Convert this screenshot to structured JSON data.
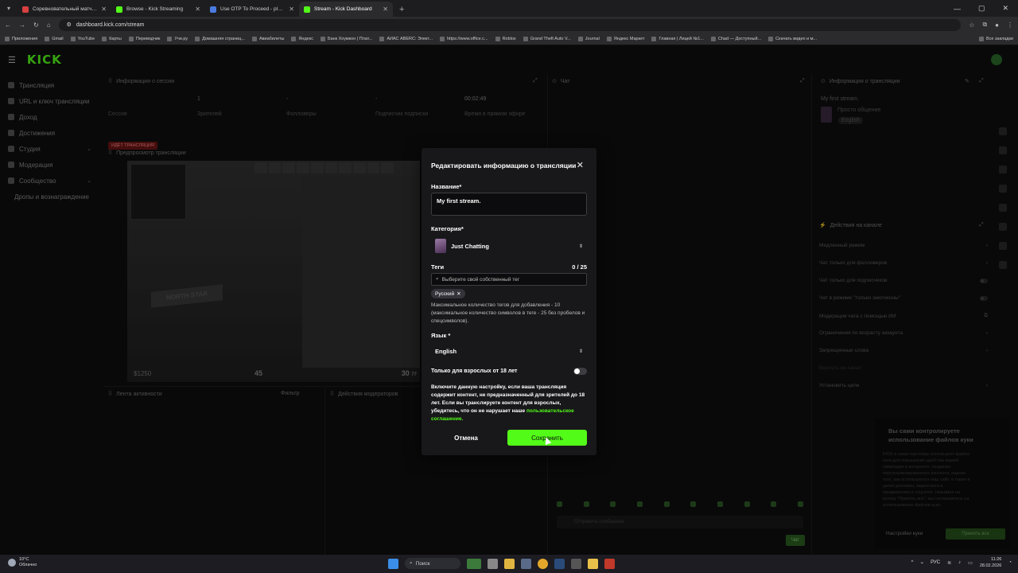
{
  "browser": {
    "tabs": [
      {
        "title": "Соревновательный матч FACEIT",
        "color": "#d94040",
        "active": false
      },
      {
        "title": "Browse - Kick Streaming",
        "color": "#53fc18",
        "active": false
      },
      {
        "title": "Use OTP To Proceed - playdig",
        "color": "#4b7be0",
        "active": false
      },
      {
        "title": "Stream - Kick Dashboard",
        "color": "#53fc18",
        "active": true
      }
    ],
    "url": "dashboard.kick.com/stream",
    "bookmarks": [
      "Приложения",
      "Gmail",
      "YouTube",
      "Карты",
      "Переводчик",
      "Учи.ру",
      "Домашняя страниц...",
      "Авиабилеты",
      "Яндекс",
      "Банк Хоумкон | Плат...",
      "АИАС ABERC: Элект...",
      "https://www.office.c...",
      "Roblox",
      "Grand Theft Auto V...",
      "Journal",
      "Яндекс Маркет",
      "Главная | Лицей №1...",
      "Chad — Доступный...",
      "Скачать видео и м..."
    ],
    "bookmarks_all": "Все закладки"
  },
  "app": {
    "logo": "KICK",
    "sidebar": [
      {
        "label": "Трансляция",
        "chevron": false,
        "sub": false
      },
      {
        "label": "URL и ключ трансляции",
        "chevron": false,
        "sub": false
      },
      {
        "label": "Доход",
        "chevron": false,
        "sub": false
      },
      {
        "label": "Достижения",
        "chevron": false,
        "sub": false
      },
      {
        "label": "Студия",
        "chevron": true,
        "sub": false
      },
      {
        "label": "Модерация",
        "chevron": false,
        "sub": false
      },
      {
        "label": "Сообщество",
        "chevron": true,
        "sub": false
      },
      {
        "label": "Дропы и вознаграждение",
        "chevron": false,
        "sub": true
      }
    ],
    "session": {
      "title": "Информация о сессии",
      "live_badge": "ИДЁТ ТРАНСЛЯЦИЯ",
      "session_label": "Сессия",
      "viewers_value": "1",
      "viewers_label": "Зрителей",
      "followers_value": "-",
      "followers_label": "Фолловеры",
      "subs_value": "-",
      "subs_label": "Подписчик подписки",
      "time_value": "00:02:49",
      "time_label": "Время в прямом эфире"
    },
    "preview": {
      "title": "Предпросмотр трансляции",
      "money": "$1250",
      "hp": "45",
      "ammo": "30",
      "ammo_reserve": "77",
      "sign": "NORTH STAR"
    },
    "activity_title": "Лента активности",
    "filter_label": "Фильтр",
    "mod_actions_title": "Действия модераторов",
    "chat": {
      "title": "Чат",
      "placeholder": "Отправить сообщение",
      "send": "Чат"
    },
    "stream_info": {
      "title": "Информация о трансляции",
      "stream_title": "My first stream.",
      "category": "Просто общение",
      "language": "English"
    },
    "channel_actions": {
      "title": "Действия на канале",
      "rows": [
        {
          "label": "Медленный режим",
          "kind": "arrow"
        },
        {
          "label": "Чат только для фолловеров",
          "kind": "arrow"
        },
        {
          "label": "Чат только для подписчиков",
          "kind": "toggle"
        },
        {
          "label": "Чат в режиме \"только эмотиконы\"",
          "kind": "toggle"
        },
        {
          "label": "Модерация чата с помощью ИИ",
          "kind": "link"
        },
        {
          "label": "Ограничения по возрасту аккаунта",
          "kind": "arrow"
        },
        {
          "label": "Запрещенные слова",
          "kind": "arrow"
        },
        {
          "label": "Вернуть на канал",
          "kind": "none"
        },
        {
          "label": "Установить цели",
          "kind": "arrow"
        }
      ]
    },
    "cookie": {
      "title": "Вы сами контролируете использование файлов куки",
      "text": "KICK и наши партнеры используют файлы куки для повышения удобства вашей навигации в интернете, создания персонализированного контента, оценки того, как используются наш сайт, а также в целях рекламы, маркетинга и продвижения в соцсетях. Нажимая на кнопку \"Принять все\", вы соглашаетесь на использование файлов куки.",
      "settings": "Настройки куки",
      "accept": "Принять все"
    }
  },
  "modal": {
    "title": "Редактировать информацию о трансляции",
    "name_label": "Название*",
    "name_value": "My first stream.",
    "category_label": "Категория*",
    "category_value": "Just Chatting",
    "tags_label": "Теги",
    "tags_count": "0 / 25",
    "tags_placeholder": "Выберите свой собственный тег",
    "chip": "Русский",
    "help": "Максимальное количество тегов для добавления - 10 (максимальное количество символов в теге - 25 без пробелов и спецсимволов).",
    "language_label": "Язык *",
    "language_value": "English",
    "adult_label": "Только для взрослых от 18 лет",
    "adult_text": "Включите данную настройку, если ваша трансляция содержит контент, не предназначенный для зрителей до 18 лет. Если вы транслируете контент для взрослых, убедитесь, что он не нарушает наше",
    "adult_link": "пользовательское соглашение.",
    "cancel": "Отмена",
    "save": "Сохранить"
  },
  "taskbar": {
    "temp": "10°C",
    "weather": "Облачно",
    "search": "Поиск",
    "lang": "РУС",
    "time": "11:26",
    "date": "28.02.2026"
  }
}
